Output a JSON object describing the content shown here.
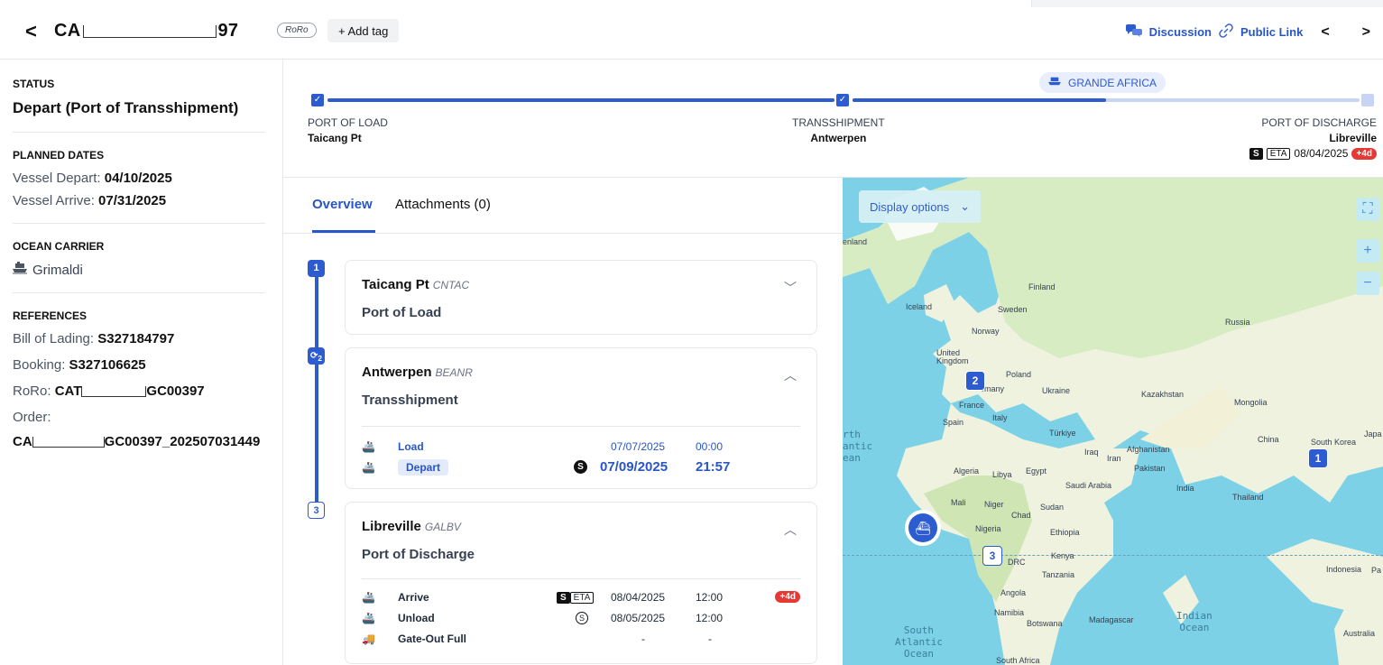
{
  "header": {
    "back": "<",
    "title_start": "CA",
    "title_end": "97",
    "mode_tag": "RoRo",
    "add_tag": "+ Add tag",
    "discussion": "Discussion",
    "public_link": "Public Link",
    "prev": "<",
    "next": ">"
  },
  "sidebar": {
    "status": {
      "heading": "STATUS",
      "value": "Depart (Port of Transshipment)"
    },
    "planned": {
      "heading": "PLANNED DATES",
      "depart_label": "Vessel Depart:",
      "depart_value": "04/10/2025",
      "arrive_label": "Vessel Arrive:",
      "arrive_value": "07/31/2025"
    },
    "carrier": {
      "heading": "OCEAN CARRIER",
      "name": "Grimaldi"
    },
    "references": {
      "heading": "REFERENCES",
      "bol_label": "Bill of Lading:",
      "bol_value": "S327184797",
      "booking_label": "Booking:",
      "booking_value": "S327106625",
      "roro_label": "RoRo:",
      "roro_start": "CAT",
      "roro_end": "GC00397",
      "order_label": "Order:",
      "order_start": "CA",
      "order_end": "GC00397_202507031449"
    }
  },
  "route": {
    "vessel": "GRANDE AFRICA",
    "pol": {
      "label": "PORT OF LOAD",
      "name": "Taicang Pt"
    },
    "ts": {
      "label": "TRANSSHIPMENT",
      "name": "Antwerpen"
    },
    "pod": {
      "label": "PORT OF DISCHARGE",
      "name": "Libreville",
      "s": "S",
      "eta": "ETA",
      "date": "08/04/2025",
      "late": "+4d"
    }
  },
  "tabs": {
    "overview": "Overview",
    "attachments": "Attachments (0)"
  },
  "timeline": {
    "nodes": [
      "1",
      "2",
      "3"
    ],
    "cards": [
      {
        "name": "Taicang Pt",
        "code": "CNTAC",
        "role": "Port of Load"
      },
      {
        "name": "Antwerpen",
        "code": "BEANR",
        "role": "Transshipment",
        "events": [
          {
            "label": "Load",
            "date": "07/07/2025",
            "time": "00:00"
          },
          {
            "label": "Depart",
            "date": "07/09/2025",
            "time": "21:57",
            "marker": "S"
          }
        ]
      },
      {
        "name": "Libreville",
        "code": "GALBV",
        "role": "Port of Discharge",
        "events": [
          {
            "label": "Arrive",
            "date": "08/04/2025",
            "time": "12:00",
            "marker": "S",
            "eta": "ETA",
            "late": "+4d"
          },
          {
            "label": "Unload",
            "date": "08/05/2025",
            "time": "12:00",
            "marker": "S"
          },
          {
            "label": "Gate-Out Full",
            "date": "-",
            "time": "-"
          }
        ]
      }
    ]
  },
  "map": {
    "display_options": "Display options",
    "labels": {
      "iceland": "Iceland",
      "finland": "Finland",
      "sweden": "Sweden",
      "norway": "Norway",
      "russia": "Russia",
      "uk": "United Kingdom",
      "poland": "Poland",
      "germany": "rmany",
      "ukraine": "Ukraine",
      "france": "France",
      "italy": "Italy",
      "spain": "Spain",
      "kazakhstan": "Kazakhstan",
      "mongolia": "Mongolia",
      "turkiye": "Türkiye",
      "iraq": "Iraq",
      "iran": "Iran",
      "afghanistan": "Afghanistan",
      "pakistan": "Pakistan",
      "china": "China",
      "southkorea": "South Korea",
      "japan": "Japa",
      "algeria": "Algeria",
      "libya": "Libya",
      "egypt": "Egypt",
      "saudi": "Saudi Arabia",
      "india": "India",
      "thailand": "Thailand",
      "mali": "Mali",
      "niger": "Niger",
      "chad": "Chad",
      "sudan": "Sudan",
      "nigeria": "Nigeria",
      "ethiopia": "Ethiopia",
      "kenya": "Kenya",
      "drc": "DRC",
      "tanzania": "Tanzania",
      "indonesia": "Indonesia",
      "pa": "Pa",
      "angola": "Angola",
      "namibia": "Namibia",
      "botswana": "Botswana",
      "madagascar": "Madagascar",
      "australia": "Australia",
      "southafrica": "South Africa",
      "landfrag": "enland",
      "north_atlantic": "rth\nantic\nean",
      "south_atlantic": "South\nAtlantic\nOcean",
      "indian": "Indian\nOcean"
    },
    "clusters": [
      "1",
      "2",
      "3"
    ]
  }
}
